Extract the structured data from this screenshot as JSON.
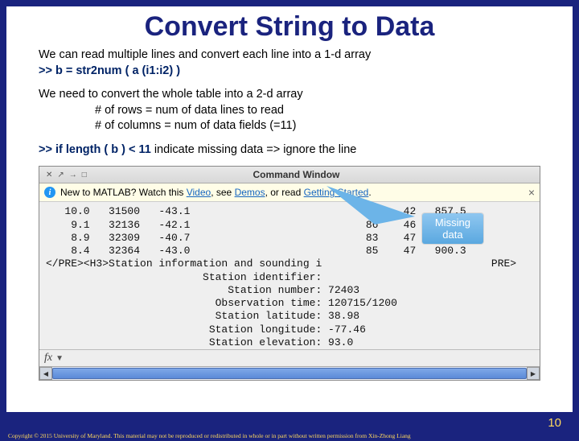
{
  "title": "Convert String to Data",
  "p1": "We can read multiple lines and convert each line into a 1-d array",
  "cmd1": ">> b = str2num ( a (i1:i2) )",
  "p2": "We need to convert the whole table into a 2-d array",
  "rows_line": "# of rows       = num of data lines to read",
  "cols_line": "# of columns = num of data fields (=11)",
  "cmd2_pre": ">> if length ( b ) < 11",
  "cmd2_post": " indicate missing data => ignore the line",
  "win": {
    "title": "Command Window",
    "icons": [
      "✕",
      "↗",
      "→",
      "□"
    ],
    "info_pre": "New to MATLAB? Watch this ",
    "info_l1": "Video",
    "info_mid1": ", see ",
    "info_l2": "Demos",
    "info_mid2": ", or read ",
    "info_l3": "Getting Started",
    "info_post": ".",
    "info_close": "×",
    "mono": "   10.0   31500   -43.1                            90    42   857.5\n    9.1   32136   -42.1                            86    46   884.8\n    8.9   32309   -40.7                            83    47   896.5\n    8.4   32364   -43.0                            85    47   900.3\n</PRE><H3>Station information and sounding i                           PRE>\n                         Station identifier:\n                             Station number: 72403\n                           Observation time: 120715/1200\n                           Station latitude: 38.98\n                          Station longitude: -77.46\n                          Station elevation: 93.0",
    "fx": "fx"
  },
  "callout_l1": "Missing",
  "callout_l2": "data",
  "pagenum": "10",
  "copyright": "Copyright © 2015 University of Maryland.  This material may not be reproduced or redistributed in whole or in part without written permission from Xin-Zhong Liang"
}
